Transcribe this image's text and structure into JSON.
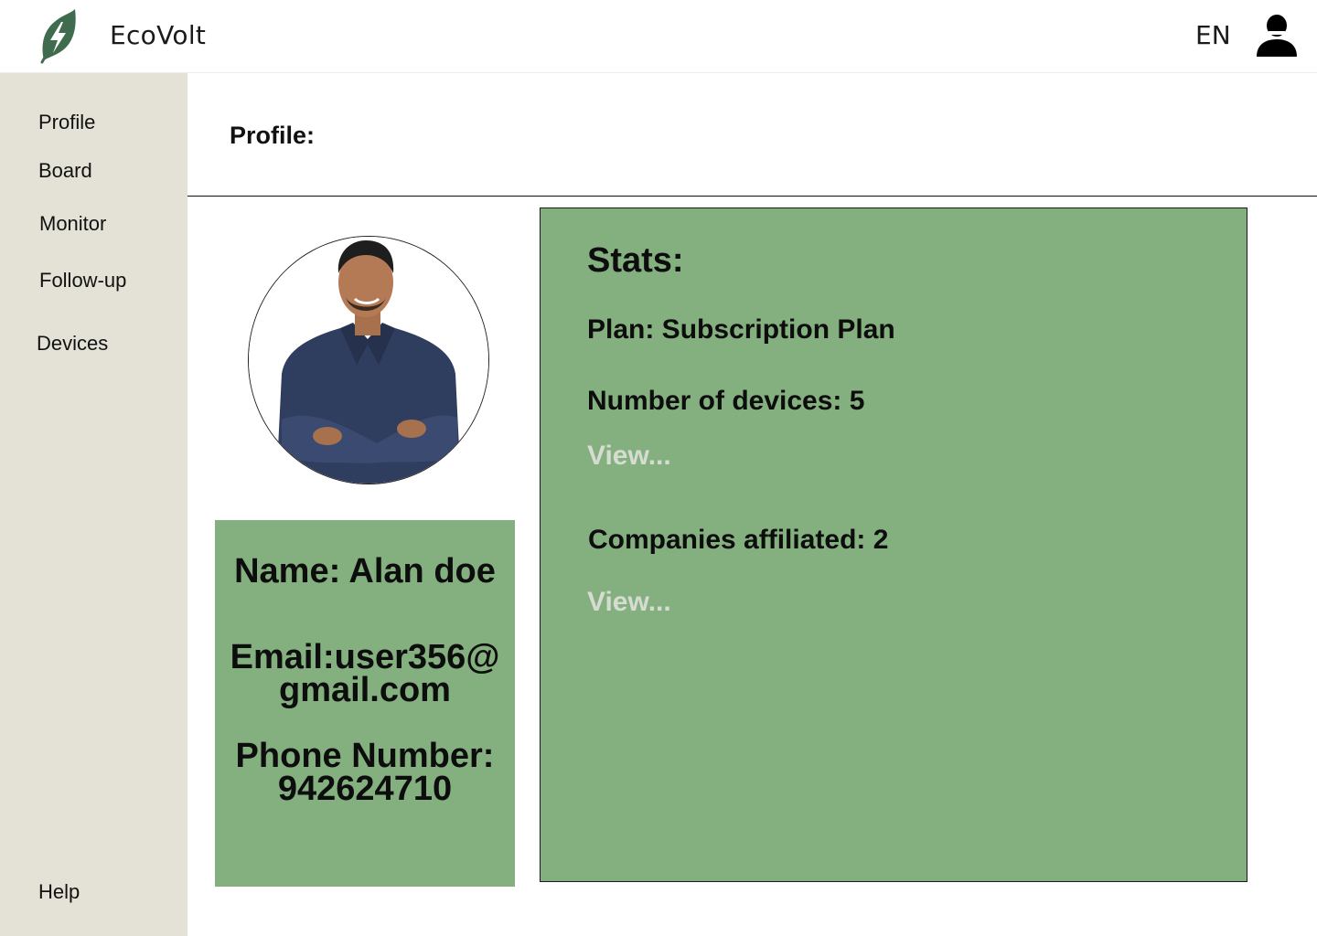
{
  "header": {
    "brand": "EcoVolt",
    "language": "EN",
    "icons": {
      "logo": "leaf-bolt-logo",
      "account": "user-icon"
    },
    "colors": {
      "logo": "#3f6b4f"
    }
  },
  "sidebar": {
    "items": [
      {
        "label": "Profile"
      },
      {
        "label": "Board"
      },
      {
        "label": "Monitor"
      },
      {
        "label": "Follow-up"
      },
      {
        "label": "Devices"
      }
    ],
    "help_label": "Help",
    "colors": {
      "background": "#e4e2d6"
    }
  },
  "main": {
    "page_title": "Profile:",
    "avatar": {
      "icon": "profile-photo"
    },
    "info_card": {
      "name": "Name: Alan doe",
      "email_line1": "Email:user356@",
      "email_line2": "gmail.com",
      "phone_line1": "Phone Number:",
      "phone_line2": "942624710"
    },
    "stats": {
      "title": "Stats:",
      "plan": "Plan: Subscription Plan",
      "devices": "Number of devices: 5",
      "devices_view": "View...",
      "companies": "Companies affiliated: 2",
      "companies_view": "View..."
    },
    "colors": {
      "card_green": "#84b07f",
      "view_link": "#d6dcd2"
    }
  }
}
